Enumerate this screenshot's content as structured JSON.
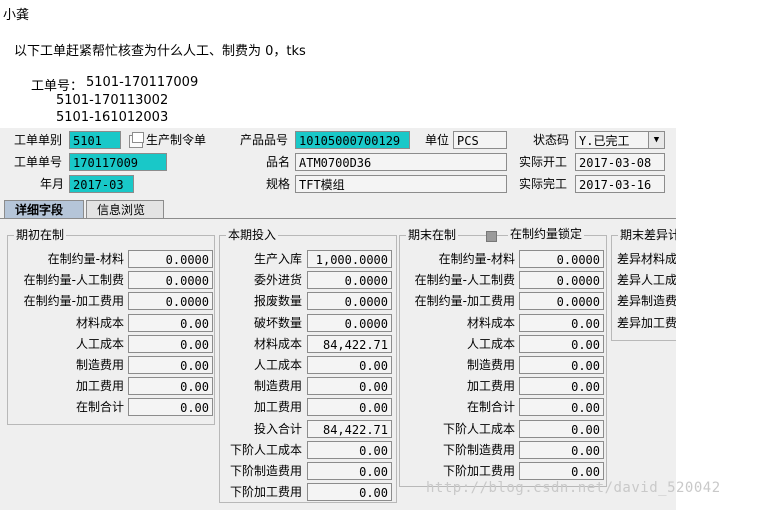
{
  "email": {
    "sender": "小龚",
    "body": "以下工单赶紧帮忙核查为什么人工、制费为 0，tks",
    "work_order_label": "工单号：",
    "work_orders": [
      "5101-170117009",
      "5101-170113002",
      "5101-161012003"
    ]
  },
  "header": {
    "order_type_label": "工单单别",
    "order_type": "5101",
    "production_order_label": "生产制令单",
    "product_no_label": "产品品号",
    "product_no": "10105000700129",
    "unit_label": "单位",
    "unit": "PCS",
    "status_label": "状态码",
    "status": "Y.已完工",
    "order_no_label": "工单单号",
    "order_no": "170117009",
    "name_label": "品名",
    "name": "ATM0700D36",
    "actual_start_label": "实际开工",
    "actual_start": "2017-03-08",
    "year_month_label": "年月",
    "year_month": "2017-03",
    "spec_label": "规格",
    "spec": "TFT模组",
    "actual_finish_label": "实际完工",
    "actual_finish": "2017-03-16"
  },
  "tabs": [
    "详细字段",
    "信息浏览"
  ],
  "group_opening": {
    "title": "期初在制",
    "rows": [
      {
        "label": "在制约量-材料",
        "value": "0.0000"
      },
      {
        "label": "在制约量-人工制费",
        "value": "0.0000"
      },
      {
        "label": "在制约量-加工费用",
        "value": "0.0000"
      },
      {
        "label": "材料成本",
        "value": "0.00"
      },
      {
        "label": "人工成本",
        "value": "0.00"
      },
      {
        "label": "制造费用",
        "value": "0.00"
      },
      {
        "label": "加工费用",
        "value": "0.00"
      },
      {
        "label": "在制合计",
        "value": "0.00"
      }
    ]
  },
  "group_current": {
    "title": "本期投入",
    "rows": [
      {
        "label": "生产入库",
        "value": "1,000.0000"
      },
      {
        "label": "委外进货",
        "value": "0.0000"
      },
      {
        "label": "报废数量",
        "value": "0.0000"
      },
      {
        "label": "破坏数量",
        "value": "0.0000"
      },
      {
        "label": "材料成本",
        "value": "84,422.71"
      },
      {
        "label": "人工成本",
        "value": "0.00"
      },
      {
        "label": "制造费用",
        "value": "0.00"
      },
      {
        "label": "加工费用",
        "value": "0.00"
      },
      {
        "label": "投入合计",
        "value": "84,422.71"
      },
      {
        "label": "下阶人工成本",
        "value": "0.00"
      },
      {
        "label": "下阶制造费用",
        "value": "0.00"
      },
      {
        "label": "下阶加工费用",
        "value": "0.00"
      }
    ]
  },
  "group_closing": {
    "title": "期末在制",
    "lock_label": "在制约量锁定",
    "rows": [
      {
        "label": "在制约量-材料",
        "value": "0.0000"
      },
      {
        "label": "在制约量-人工制费",
        "value": "0.0000"
      },
      {
        "label": "在制约量-加工费用",
        "value": "0.0000"
      },
      {
        "label": "材料成本",
        "value": "0.00"
      },
      {
        "label": "人工成本",
        "value": "0.00"
      },
      {
        "label": "制造费用",
        "value": "0.00"
      },
      {
        "label": "加工费用",
        "value": "0.00"
      },
      {
        "label": "在制合计",
        "value": "0.00"
      },
      {
        "label": "下阶人工成本",
        "value": "0.00"
      },
      {
        "label": "下阶制造费用",
        "value": "0.00"
      },
      {
        "label": "下阶加工费用",
        "value": "0.00"
      }
    ]
  },
  "group_variance": {
    "title": "期末差异计",
    "rows": [
      "差异材料成",
      "差异人工成",
      "差异制造费",
      "差异加工费"
    ]
  },
  "watermark": "http://blog.csdn.net/david_520042"
}
